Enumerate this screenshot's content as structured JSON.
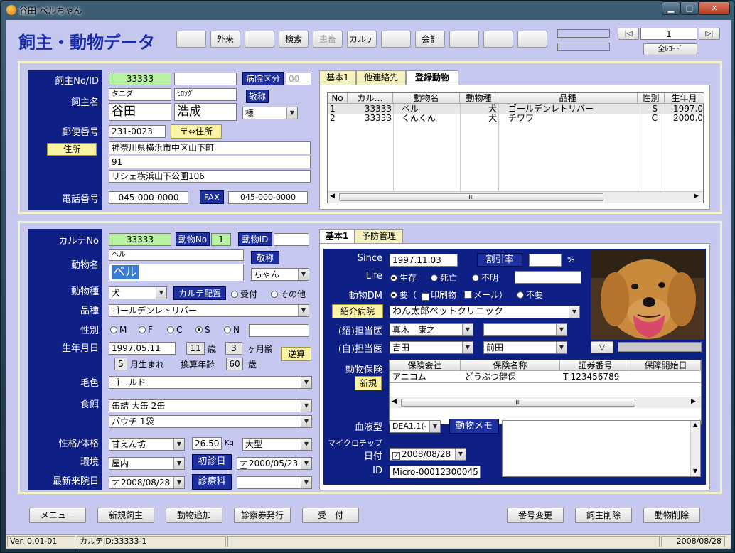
{
  "window": {
    "title": "谷田-ベルちゃん",
    "min": "▁",
    "max": "□",
    "close": "✕"
  },
  "header": {
    "title": "飼主・動物データ",
    "buttons": [
      "",
      "外来",
      "",
      "検索",
      "患畜",
      "カルテ",
      "",
      "会計",
      "",
      "",
      ""
    ],
    "record_first": "|◁",
    "record_last": "▷|",
    "record_no": "1",
    "all_records": "全ﾚｺｰﾄﾞ"
  },
  "owner": {
    "owner_id_label": "飼主No/ID",
    "owner_id": "33333",
    "owner_id2": "",
    "hospital_class_label": "病院区分",
    "hospital_class": "00",
    "owner_name_label": "飼主名",
    "kana_last": "タニダ",
    "kana_first": "ﾋﾛﾂｸﾞ",
    "last_name": "谷田",
    "first_name": "浩成",
    "honorific_btn": "敬称",
    "honorific": "様",
    "postal_label": "郵便番号",
    "postal": "231-0023",
    "postal_to_addr": "〒⇔住所",
    "address_btn": "住所",
    "addr1": "神奈川県横浜市中区山下町",
    "addr2": "91",
    "addr3": "リシェ横浜山下公園106",
    "phone_label": "電話番号",
    "phone": "045-000-0000",
    "fax_label": "FAX",
    "fax": "045-000-0000"
  },
  "owner_tabs": [
    "基本1",
    "他連絡先",
    "登録動物"
  ],
  "animals_grid": {
    "headers": [
      "No",
      "カル…",
      "動物名",
      "動物種",
      "品種",
      "性別",
      "生年月"
    ],
    "rows": [
      [
        "1",
        "33333",
        "ベル",
        "犬",
        "ゴールデンレトリバー",
        "S",
        "1997.0"
      ],
      [
        "2",
        "33333",
        "くんくん",
        "犬",
        "チワワ",
        "C",
        "2000.0"
      ]
    ],
    "scroll_thumb": "III"
  },
  "animal": {
    "karte_label": "カルテNo",
    "karte_no": "33333",
    "animal_no_label": "動物No",
    "animal_no": "1",
    "animal_id_label": "動物ID",
    "animal_id": "",
    "name_label": "動物名",
    "name_kana": "ベル",
    "name": "ベル",
    "honorific_btn": "敬称",
    "honorific": "ちゃん",
    "species_label": "動物種",
    "species": "犬",
    "karte_place_btn": "カルテ配置",
    "place_reception": "受付",
    "place_other": "その他",
    "breed_label": "品種",
    "breed": "ゴールデンレトリバー",
    "sex_label": "性別",
    "sex_options": [
      "M",
      "F",
      "C",
      "S",
      "N"
    ],
    "sex_extra": "",
    "birth_label": "生年月日",
    "birth": "1997.05.11",
    "age_years": "11",
    "years_unit": "歳",
    "age_months": "3",
    "months_unit": "ヶ月齢",
    "reverse_calc": "逆算",
    "born_month": "5",
    "born_month_unit": "月生まれ",
    "human_age_label": "換算年齢",
    "human_age": "60",
    "human_age_unit": "歳",
    "color_label": "毛色",
    "color": "ゴールド",
    "food_label": "食餌",
    "food1": "缶詰 大缶 2缶",
    "food2": "パウチ 1袋",
    "temper_label": "性格/体格",
    "temper": "甘えん坊",
    "weight": "26.50",
    "weight_unit": "Kg",
    "size": "大型",
    "env_label": "環境",
    "env": "屋内",
    "first_visit_label": "初診日",
    "first_visit": "2000/05/23",
    "last_visit_label": "最新来院日",
    "last_visit": "2008/08/28",
    "fee_label": "診療料",
    "fee": ""
  },
  "animal_tabs": [
    "基本1",
    "予防管理"
  ],
  "basic": {
    "since_label": "Since",
    "since": "1997.11.03",
    "discount_btn": "割引率",
    "discount": "",
    "discount_unit": "%",
    "life_label": "Life",
    "life_options": [
      "生存",
      "死亡",
      "不明"
    ],
    "life_extra": "",
    "dm_label": "動物DM",
    "dm_need": "要（",
    "dm_print": "印刷物",
    "dm_mail": "メール）",
    "dm_none": "不要",
    "referral_btn": "紹介病院",
    "referral": "わん太郎ペットクリニック",
    "ref_doctor_label": "(紹)担当医",
    "ref_doctor": "真木　康之",
    "ref_doctor2": "",
    "own_doctor_label": "(自)担当医",
    "own_doctor": "吉田",
    "own_doctor2": "前田",
    "insurance_label": "動物保険",
    "new_btn": "新規",
    "ins_headers": [
      "保険会社",
      "保険名称",
      "証券番号",
      "保障開始日"
    ],
    "ins_rows": [
      [
        "アニコム",
        "どうぶつ健保",
        "T-123456789",
        ""
      ]
    ],
    "blood_label": "血液型",
    "blood": "DEA1.1(-",
    "memo_btn": "動物メモ",
    "memo": "",
    "chip_label": "マイクロチップ",
    "chip_date_label": "日付",
    "chip_date": "2008/08/28",
    "chip_id_label": "ID",
    "chip_id": "Micro-00012300045",
    "photo_down": "▽"
  },
  "footer_buttons": [
    "メニュー",
    "新規飼主",
    "動物追加",
    "診察券発行",
    "受　付",
    "番号変更",
    "飼主削除",
    "動物削除"
  ],
  "statusbar": {
    "version": "Ver. 0.01-01",
    "karte": "カルテID:33333-1",
    "date": "2008/08/28"
  },
  "colors": {
    "background": "#c6c8ef",
    "label_panel": "#0e1f86",
    "accent_button": "#1d2f9e",
    "panel_border": "#f4f4c8",
    "highlight_field": "#b6f2a0"
  }
}
